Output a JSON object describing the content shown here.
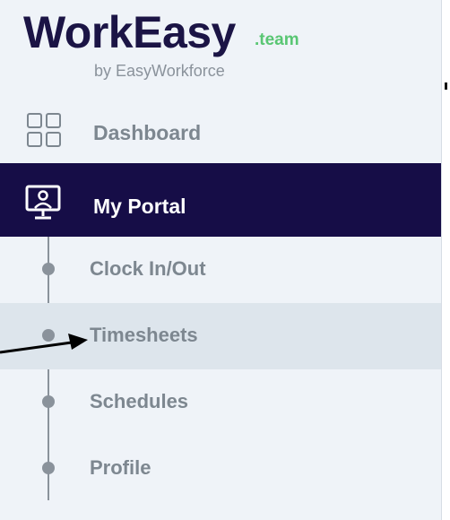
{
  "brand": {
    "name": "WorkEasy",
    "suffix": ".team",
    "byline": "by EasyWorkforce",
    "colors": {
      "navy": "#160d47",
      "green": "#59c673",
      "gray": "#7d8790"
    }
  },
  "nav": {
    "dashboard": {
      "label": "Dashboard",
      "icon": "grid-icon"
    },
    "portal": {
      "label": "My Portal",
      "icon": "monitor-user-icon",
      "state": "selected"
    }
  },
  "subnav": {
    "items": [
      {
        "label": "Clock In/Out"
      },
      {
        "label": "Timesheets",
        "state": "highlighted"
      },
      {
        "label": "Schedules"
      },
      {
        "label": "Profile"
      }
    ]
  },
  "annotation": {
    "icon": "pointer-arrow",
    "points_to": "Timesheets"
  }
}
